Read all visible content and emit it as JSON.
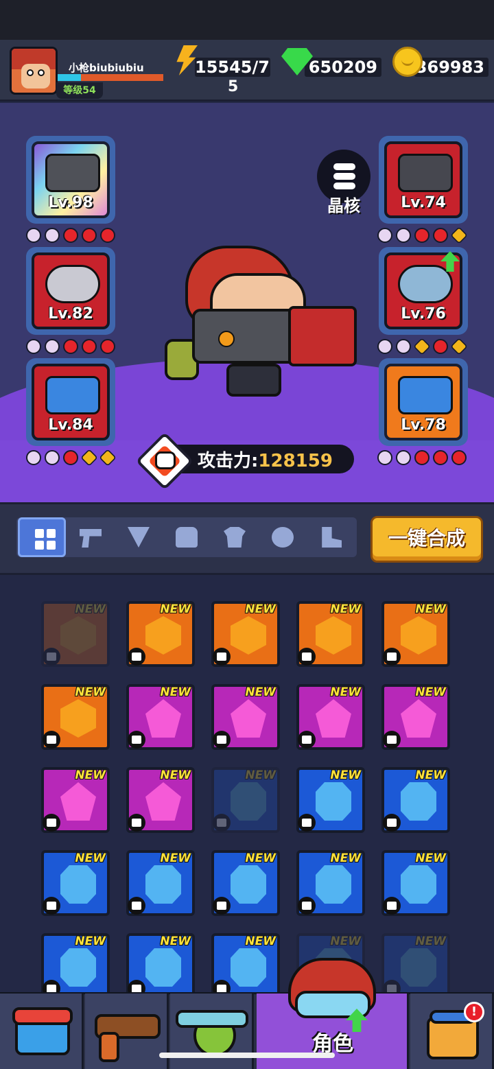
{
  "player": {
    "name": "小枪biubiubiu",
    "level_label": "等级54",
    "xp_fraction": 1.0
  },
  "resources": {
    "energy_line1": "15545/7",
    "energy_line2": "5",
    "gems": "650209",
    "coins": "369983"
  },
  "equipment": {
    "weapon": {
      "level": "Lv.98",
      "icon": "cannon-icon"
    },
    "necklace": {
      "level": "Lv.82",
      "icon": "chain-necklace-icon"
    },
    "glove": {
      "level": "Lv.84",
      "icon": "gauntlet-icon"
    },
    "armor": {
      "level": "Lv.74",
      "icon": "armor-icon"
    },
    "belt": {
      "level": "Lv.76",
      "icon": "skull-belt-icon",
      "upgrade_available": true
    },
    "boots": {
      "level": "Lv.78",
      "icon": "boots-icon"
    }
  },
  "crystal_core": {
    "label": "晶核"
  },
  "attack": {
    "label": "攻击力:",
    "value": "128159"
  },
  "filters": {
    "tabs": [
      "all",
      "weapon",
      "necklace",
      "glove",
      "armor",
      "belt",
      "boots"
    ],
    "active": "all",
    "merge_label": "一键合成"
  },
  "inventory": {
    "new_label": "NEW",
    "items": [
      {
        "rarity": "orange",
        "slot": "glove",
        "dim": true
      },
      {
        "rarity": "orange",
        "slot": "armor",
        "dim": false
      },
      {
        "rarity": "orange",
        "slot": "armor",
        "dim": false
      },
      {
        "rarity": "orange",
        "slot": "glove",
        "dim": false
      },
      {
        "rarity": "orange",
        "slot": "armor",
        "dim": false
      },
      {
        "rarity": "orange",
        "slot": "necklace",
        "dim": false
      },
      {
        "rarity": "purple",
        "slot": "necklace",
        "dim": false
      },
      {
        "rarity": "purple",
        "slot": "necklace",
        "dim": false
      },
      {
        "rarity": "purple",
        "slot": "armor",
        "dim": false
      },
      {
        "rarity": "purple",
        "slot": "necklace",
        "dim": false
      },
      {
        "rarity": "purple",
        "slot": "boots",
        "dim": false
      },
      {
        "rarity": "purple",
        "slot": "necklace",
        "dim": false
      },
      {
        "rarity": "blue",
        "slot": "weapon",
        "dim": true
      },
      {
        "rarity": "blue",
        "slot": "glove",
        "dim": false
      },
      {
        "rarity": "blue",
        "slot": "glove",
        "dim": false
      },
      {
        "rarity": "blue",
        "slot": "armor",
        "dim": false
      },
      {
        "rarity": "blue",
        "slot": "armor",
        "dim": false
      },
      {
        "rarity": "blue",
        "slot": "armor",
        "dim": false
      },
      {
        "rarity": "blue",
        "slot": "belt",
        "dim": false
      },
      {
        "rarity": "blue",
        "slot": "boots",
        "dim": false
      },
      {
        "rarity": "blue",
        "slot": "boots",
        "dim": false
      },
      {
        "rarity": "blue",
        "slot": "belt",
        "dim": false
      },
      {
        "rarity": "blue",
        "slot": "belt",
        "dim": false
      },
      {
        "rarity": "blue",
        "slot": "armor",
        "dim": true
      },
      {
        "rarity": "blue",
        "slot": "armor",
        "dim": true
      }
    ]
  },
  "nav": {
    "items": [
      "shop",
      "weapons",
      "pets",
      "character",
      "castle"
    ],
    "active": "character",
    "active_label": "角色",
    "notification": "!"
  },
  "colors": {
    "rarity_orange": "#e96f16",
    "rarity_purple": "#b728b8",
    "rarity_blue": "#1c59d6",
    "accent_yellow": "#f5b92c",
    "attack_value": "#f7c24a",
    "platform_purple": "#7a45d6"
  }
}
